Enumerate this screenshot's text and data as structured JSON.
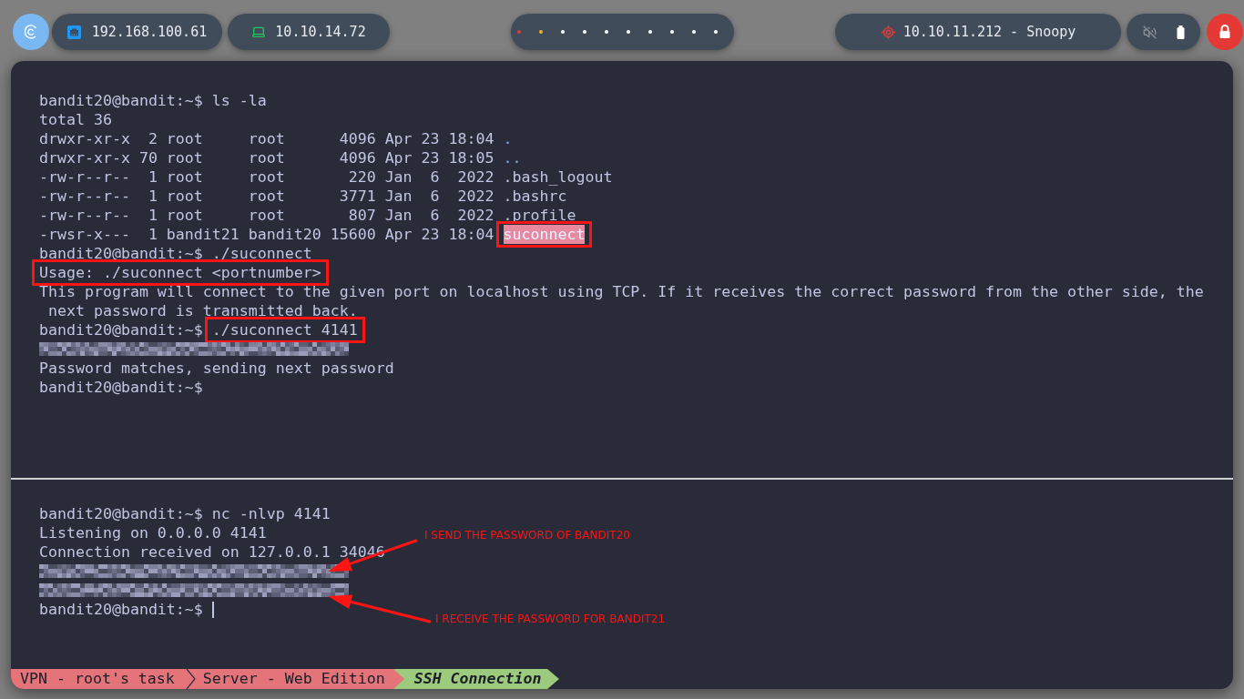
{
  "top_bar": {
    "interfaces": [
      {
        "kind": "lan",
        "address": "192.168.100.61"
      },
      {
        "kind": "vpn",
        "address": "10.10.14.72"
      }
    ],
    "workspaces": [
      {
        "color": "#e53935"
      },
      {
        "color": "#f6b21b"
      },
      {
        "color": "#ffffff"
      },
      {
        "color": "#ffffff"
      },
      {
        "color": "#ffffff"
      },
      {
        "color": "#ffffff"
      },
      {
        "color": "#ffffff"
      },
      {
        "color": "#ffffff"
      },
      {
        "color": "#ffffff"
      },
      {
        "color": "#ffffff"
      }
    ],
    "target": {
      "address": "10.10.11.212 - Snoopy"
    }
  },
  "top_pane": {
    "lines": [
      {
        "kind": "prompt",
        "prompt": "bandit20@bandit:~$",
        "command": "ls -la",
        "boxed": false,
        "cursor": false
      },
      {
        "kind": "output",
        "text": "total 36",
        "boxed": false,
        "cursor": false
      },
      {
        "kind": "listing",
        "fields": "drwxr-xr-x  2 root     root      4096 Apr 23 18:04",
        "entry": {
          "name": ".",
          "kind": "dir"
        },
        "boxed": false,
        "cursor": false
      },
      {
        "kind": "listing",
        "fields": "drwxr-xr-x 70 root     root      4096 Apr 23 18:05",
        "entry": {
          "name": "..",
          "kind": "dir"
        },
        "boxed": false,
        "cursor": false
      },
      {
        "kind": "listing",
        "fields": "-rw-r--r--  1 root     root       220 Jan  6  2022",
        "entry": {
          "name": ".bash_logout",
          "kind": "file"
        },
        "boxed": false,
        "cursor": false
      },
      {
        "kind": "listing",
        "fields": "-rw-r--r--  1 root     root      3771 Jan  6  2022",
        "entry": {
          "name": ".bashrc",
          "kind": "file"
        },
        "boxed": false,
        "cursor": false
      },
      {
        "kind": "listing",
        "fields": "-rw-r--r--  1 root     root       807 Jan  6  2022",
        "entry": {
          "name": ".profile",
          "kind": "file"
        },
        "boxed": false,
        "cursor": false
      },
      {
        "kind": "listing",
        "fields": "-rwsr-x---  1 bandit21 bandit20 15600 Apr 23 18:04",
        "entry": {
          "name": "suconnect",
          "kind": "setuid"
        },
        "boxed": true,
        "cursor": false
      },
      {
        "kind": "prompt",
        "prompt": "bandit20@bandit:~$",
        "command": "./suconnect",
        "boxed": false,
        "cursor": false
      },
      {
        "kind": "output",
        "text": "Usage: ./suconnect <portnumber>",
        "boxed": true,
        "cursor": false
      },
      {
        "kind": "output",
        "text": "This program will connect to the given port on localhost using TCP. If it receives the correct password from the other side, the",
        "boxed": false,
        "cursor": false
      },
      {
        "kind": "output",
        "text": " next password is transmitted back.",
        "boxed": false,
        "cursor": false
      },
      {
        "kind": "prompt",
        "prompt": "bandit20@bandit:~$",
        "command": "./suconnect 4141",
        "boxed": true,
        "cursor": false
      },
      {
        "kind": "redacted",
        "boxed": false,
        "cursor": false
      },
      {
        "kind": "output",
        "text": "Password matches, sending next password",
        "boxed": false,
        "cursor": false
      },
      {
        "kind": "prompt",
        "prompt": "bandit20@bandit:~$",
        "boxed": false,
        "cursor": false
      }
    ]
  },
  "bottom_pane": {
    "lines": [
      {
        "kind": "prompt",
        "prompt": "bandit20@bandit:~$",
        "command": "nc -nlvp 4141",
        "boxed": false,
        "cursor": false
      },
      {
        "kind": "output",
        "text": "Listening on 0.0.0.0 4141",
        "boxed": false,
        "cursor": false
      },
      {
        "kind": "output",
        "text": "Connection received on 127.0.0.1 34046",
        "boxed": false,
        "cursor": false
      },
      {
        "kind": "redacted",
        "boxed": false,
        "cursor": false
      },
      {
        "kind": "redacted",
        "boxed": false,
        "cursor": false
      },
      {
        "kind": "prompt",
        "prompt": "bandit20@bandit:~$",
        "boxed": false,
        "cursor": true
      }
    ],
    "annotations": [
      {
        "text": "I SEND THE PASSWORD OF BANDIT20"
      },
      {
        "text": "I RECEIVE THE PASSWORD FOR BANDIT21"
      }
    ]
  },
  "status_bar": {
    "tabs": [
      {
        "label": "VPN - root's task",
        "selected": false
      },
      {
        "label": "Server - Web Edition",
        "selected": false
      },
      {
        "label": "SSH Connection",
        "selected": true
      }
    ]
  }
}
